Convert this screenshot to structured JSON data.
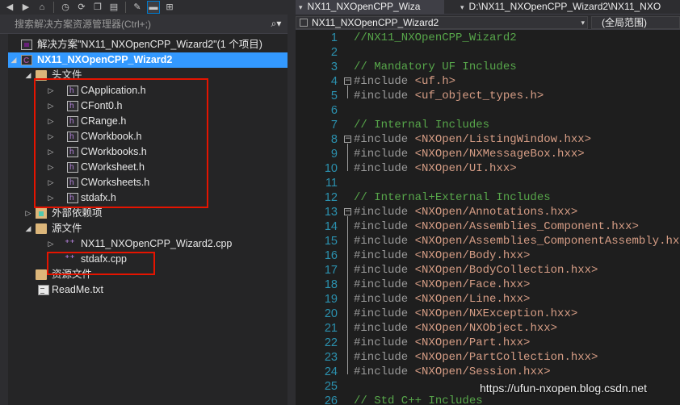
{
  "toolbar": {
    "icons": [
      "back-icon",
      "forward-icon",
      "home-icon",
      "history-icon",
      "sync-icon",
      "copy-icon",
      "properties-icon",
      "collapse-icon",
      "network-icon"
    ]
  },
  "search": {
    "placeholder": "搜索解决方案资源管理器(Ctrl+;)",
    "button_glyph": "⌕▾"
  },
  "tree": {
    "solution": "解决方案\"NX11_NXOpenCPP_Wizard2\"(1 个项目)",
    "project": "NX11_NXOpenCPP_Wizard2",
    "headers_folder": "头文件",
    "headers": [
      "CApplication.h",
      "CFont0.h",
      "CRange.h",
      "CWorkbook.h",
      "CWorkbooks.h",
      "CWorksheet.h",
      "CWorksheets.h",
      "stdafx.h"
    ],
    "external_deps": "外部依赖项",
    "source_folder": "源文件",
    "sources": [
      "NX11_NXOpenCPP_Wizard2.cpp",
      "stdafx.cpp"
    ],
    "resource_folder": "资源文件",
    "readme": "ReadMe.txt"
  },
  "editor": {
    "tab_active": "NX11_NXOpenCPP_Wiza",
    "tab_path": "D:\\NX11_NXOpenCPP_Wizard2\\NX11_NXO",
    "nav_project": "NX11_NXOpenCPP_Wizard2",
    "nav_scope": "(全局范围)",
    "lines": [
      {
        "n": "1",
        "text": "//NX11_NXOpenCPP_Wizard2",
        "kind": "comment"
      },
      {
        "n": "2",
        "text": "",
        "kind": "blank"
      },
      {
        "n": "3",
        "text": "// Mandatory UF Includes",
        "kind": "comment"
      },
      {
        "n": "4",
        "text": "<uf.h>",
        "kind": "include",
        "fold": "start"
      },
      {
        "n": "5",
        "text": "<uf_object_types.h>",
        "kind": "include",
        "fold": "end"
      },
      {
        "n": "6",
        "text": "",
        "kind": "blank"
      },
      {
        "n": "7",
        "text": "// Internal Includes",
        "kind": "comment"
      },
      {
        "n": "8",
        "text": "<NXOpen/ListingWindow.hxx>",
        "kind": "include",
        "fold": "start"
      },
      {
        "n": "9",
        "text": "<NXOpen/NXMessageBox.hxx>",
        "kind": "include",
        "fold": "mid"
      },
      {
        "n": "10",
        "text": "<NXOpen/UI.hxx>",
        "kind": "include",
        "fold": "end"
      },
      {
        "n": "11",
        "text": "",
        "kind": "blank"
      },
      {
        "n": "12",
        "text": "// Internal+External Includes",
        "kind": "comment"
      },
      {
        "n": "13",
        "text": "<NXOpen/Annotations.hxx>",
        "kind": "include",
        "fold": "start"
      },
      {
        "n": "14",
        "text": "<NXOpen/Assemblies_Component.hxx>",
        "kind": "include",
        "fold": "mid"
      },
      {
        "n": "15",
        "text": "<NXOpen/Assemblies_ComponentAssembly.hxx>",
        "kind": "include",
        "fold": "mid"
      },
      {
        "n": "16",
        "text": "<NXOpen/Body.hxx>",
        "kind": "include",
        "fold": "mid"
      },
      {
        "n": "17",
        "text": "<NXOpen/BodyCollection.hxx>",
        "kind": "include",
        "fold": "mid"
      },
      {
        "n": "18",
        "text": "<NXOpen/Face.hxx>",
        "kind": "include",
        "fold": "mid"
      },
      {
        "n": "19",
        "text": "<NXOpen/Line.hxx>",
        "kind": "include",
        "fold": "mid"
      },
      {
        "n": "20",
        "text": "<NXOpen/NXException.hxx>",
        "kind": "include",
        "fold": "mid"
      },
      {
        "n": "21",
        "text": "<NXOpen/NXObject.hxx>",
        "kind": "include",
        "fold": "mid"
      },
      {
        "n": "22",
        "text": "<NXOpen/Part.hxx>",
        "kind": "include",
        "fold": "mid"
      },
      {
        "n": "23",
        "text": "<NXOpen/PartCollection.hxx>",
        "kind": "include",
        "fold": "mid"
      },
      {
        "n": "24",
        "text": "<NXOpen/Session.hxx>",
        "kind": "include",
        "fold": "end"
      },
      {
        "n": "25",
        "text": "",
        "kind": "blank"
      },
      {
        "n": "26",
        "text": "// Std C++ Includes",
        "kind": "comment"
      }
    ],
    "include_keyword": "#include "
  },
  "watermark": "https://ufun-nxopen.blog.csdn.net",
  "colors": {
    "selection": "#3399ff",
    "comment": "#57a64a",
    "include_path": "#d69d85",
    "line_number": "#2b91af",
    "highlight_box": "#e51400"
  }
}
